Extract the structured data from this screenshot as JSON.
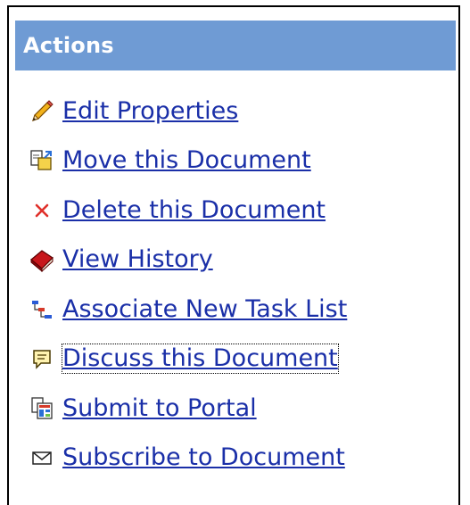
{
  "panel": {
    "title": "Actions",
    "header_color": "#6f9bd4",
    "link_color": "#1a2fa8"
  },
  "actions": [
    {
      "label": "Edit Properties",
      "icon": "pencil-icon"
    },
    {
      "label": "Move this Document",
      "icon": "move-document-icon"
    },
    {
      "label": "Delete this Document",
      "icon": "delete-x-icon"
    },
    {
      "label": "View History",
      "icon": "book-icon"
    },
    {
      "label": "Associate New Task List",
      "icon": "task-list-icon"
    },
    {
      "label": "Discuss this Document",
      "icon": "discussion-icon",
      "focused": true
    },
    {
      "label": "Submit to Portal",
      "icon": "submit-portal-icon"
    },
    {
      "label": "Subscribe to Document",
      "icon": "envelope-icon"
    }
  ]
}
